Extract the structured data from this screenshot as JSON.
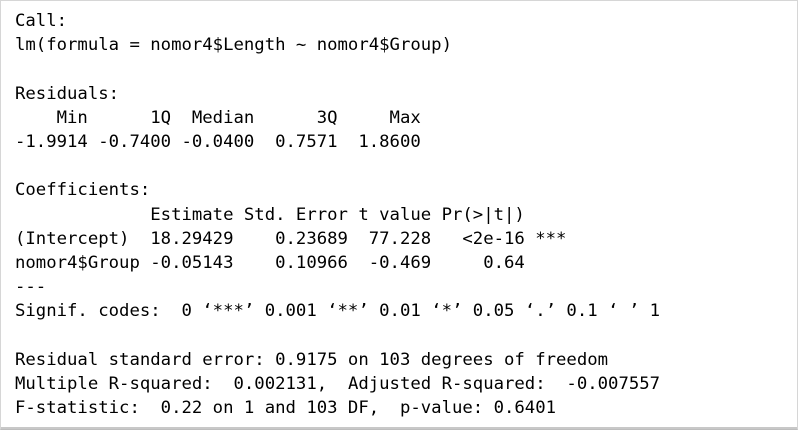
{
  "output": {
    "call_header": "Call:",
    "call_formula": "lm(formula = nomor4$Length ~ nomor4$Group)",
    "residuals_header": "Residuals:",
    "residuals_labels": "    Min      1Q  Median      3Q     Max ",
    "residuals_values": "-1.9914 -0.7400 -0.0400  0.7571  1.8600 ",
    "coefficients_header": "Coefficients:",
    "coef_column_headers": "             Estimate Std. Error t value Pr(>|t|)    ",
    "coef_row_intercept": "(Intercept)  18.29429    0.23689  77.228   <2e-16 ***",
    "coef_row_group": "nomor4$Group -0.05143    0.10966  -0.469     0.64    ",
    "separator": "---",
    "signif_codes": "Signif. codes:  0 ‘***’ 0.001 ‘**’ 0.01 ‘*’ 0.05 ‘.’ 0.1 ‘ ’ 1",
    "residual_std_error": "Residual standard error: 0.9175 on 103 degrees of freedom",
    "r_squared": "Multiple R-squared:  0.002131,\tAdjusted R-squared:  -0.007557 ",
    "f_statistic": "F-statistic:  0.22 on 1 and 103 DF,  p-value: 0.6401"
  }
}
